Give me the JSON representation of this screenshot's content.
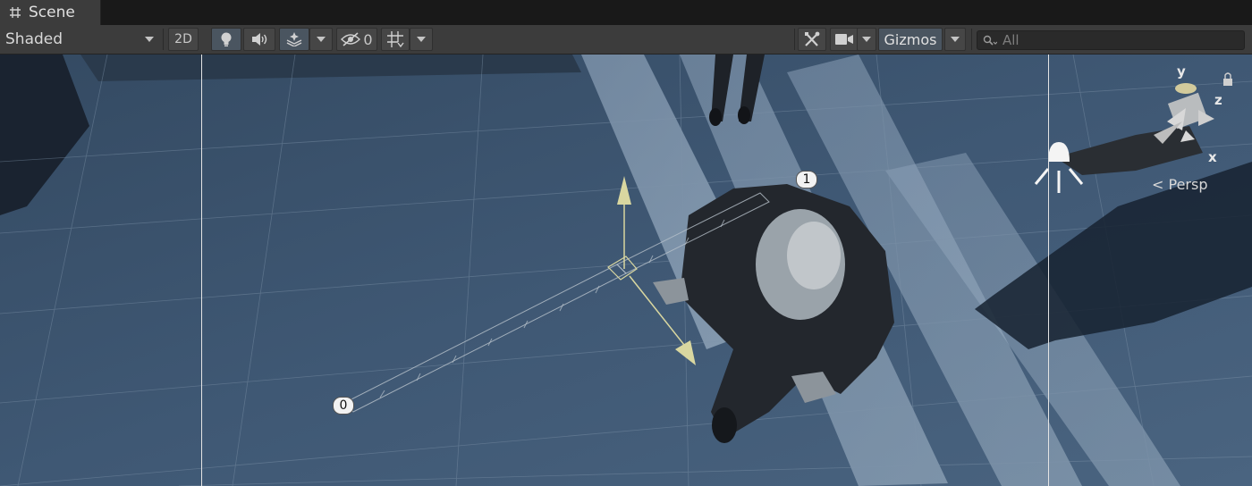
{
  "tab": {
    "title": "Scene"
  },
  "toolbar": {
    "shading_mode": "Shaded",
    "btn_2d": "2D",
    "hidden_count": "0",
    "gizmos_label": "Gizmos",
    "search_placeholder": "All"
  },
  "viewport": {
    "projection_label": "Persp",
    "axis_y": "y",
    "axis_z": "z",
    "axis_x": "x",
    "waypoint_start": "0",
    "waypoint_end": "1"
  },
  "icons": {
    "tab": "scene-grid-icon",
    "lighting": "lightbulb-icon",
    "audio": "speaker-icon",
    "effects": "effects-layers-icon",
    "visibility": "eye-slash-icon",
    "grid": "grid-icon",
    "tools": "tools-icon",
    "camera": "camera-icon",
    "search": "search-icon",
    "light_gizmo": "light-gizmo-icon",
    "lock": "lock-icon"
  },
  "colors": {
    "editor_bg": "#3c3c3c",
    "active_button": "#4a5560",
    "floor": "#3d5570",
    "move_handle": "#d9d7a0"
  }
}
